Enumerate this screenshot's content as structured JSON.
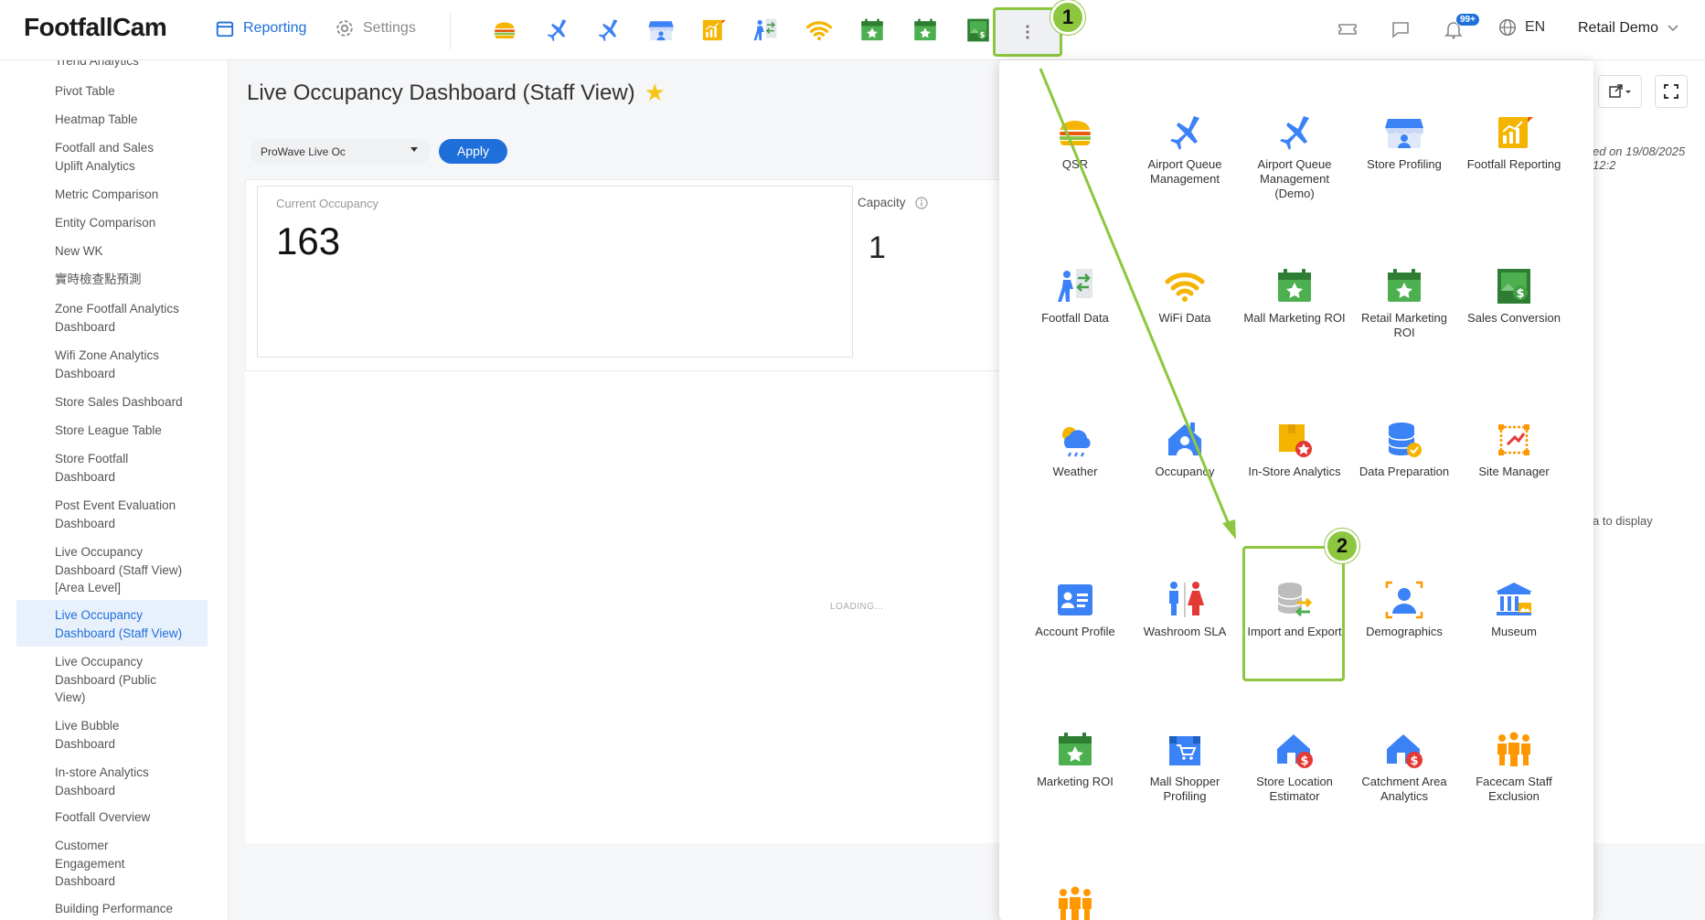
{
  "brand": {
    "name": "FootfallCam"
  },
  "nav": {
    "reporting": "Reporting",
    "settings": "Settings"
  },
  "quick_icons": [
    "burger-icon",
    "airplane-icon",
    "airplane-icon",
    "store-icon",
    "chart-report-icon",
    "people-flow-icon",
    "wifi-icon",
    "calendar-star-icon",
    "calendar-star-icon",
    "money-card-icon"
  ],
  "header": {
    "notif_badge": "99+",
    "lang": "EN",
    "user": "Retail Demo"
  },
  "callouts": {
    "one": "1",
    "two": "2"
  },
  "sidebar": {
    "items": [
      {
        "label": "Trend Analytics"
      },
      {
        "label": "Pivot Table"
      },
      {
        "label": "Heatmap Table"
      },
      {
        "label": "Footfall and Sales Uplift Analytics"
      },
      {
        "label": "Metric Comparison"
      },
      {
        "label": "Entity Comparison"
      },
      {
        "label": "New WK"
      },
      {
        "label": "實時檢查點預測"
      },
      {
        "label": "Zone Footfall Analytics Dashboard"
      },
      {
        "label": "Wifi Zone Analytics Dashboard"
      },
      {
        "label": "Store Sales Dashboard"
      },
      {
        "label": "Store League Table"
      },
      {
        "label": "Store Footfall Dashboard"
      },
      {
        "label": "Post Event Evaluation Dashboard"
      },
      {
        "label": "Live Occupancy Dashboard (Staff View) [Area Level]"
      },
      {
        "label": "Live Occupancy Dashboard (Staff View)"
      },
      {
        "label": "Live Occupancy Dashboard (Public View)"
      },
      {
        "label": "Live Bubble Dashboard"
      },
      {
        "label": "In-store Analytics Dashboard"
      },
      {
        "label": "Footfall Overview"
      },
      {
        "label": "Customer Engagement Dashboard"
      },
      {
        "label": "Building Performance"
      }
    ]
  },
  "page": {
    "title": "Live Occupancy Dashboard (Staff View)",
    "select_value": "ProWave Live Oc",
    "apply": "Apply",
    "current_occupancy_label": "Current Occupancy",
    "current_occupancy_value": "163",
    "capacity_label": "Capacity",
    "capacity_value": "1",
    "loading": "LOADING...",
    "updated_text": "ed on 19/08/2025 12:2",
    "nodata_text": "a to display"
  },
  "apps": [
    {
      "label": "QSR",
      "icon": "burger-icon"
    },
    {
      "label": "Airport Queue Management",
      "icon": "airplane-icon"
    },
    {
      "label": "Airport Queue Management (Demo)",
      "icon": "airplane-icon"
    },
    {
      "label": "Store Profiling",
      "icon": "store-icon"
    },
    {
      "label": "Footfall Reporting",
      "icon": "chart-report-icon"
    },
    {
      "label": "Footfall Data",
      "icon": "people-flow-icon"
    },
    {
      "label": "WiFi Data",
      "icon": "wifi-icon"
    },
    {
      "label": "Mall Marketing ROI",
      "icon": "calendar-star-icon"
    },
    {
      "label": "Retail Marketing ROI",
      "icon": "calendar-star-icon"
    },
    {
      "label": "Sales Conversion",
      "icon": "money-card-icon"
    },
    {
      "label": "Weather",
      "icon": "weather-icon"
    },
    {
      "label": "Occupancy",
      "icon": "house-person-icon"
    },
    {
      "label": "In-Store Analytics",
      "icon": "box-star-icon"
    },
    {
      "label": "Data Preparation",
      "icon": "database-icon"
    },
    {
      "label": "Site Manager",
      "icon": "site-manager-icon"
    },
    {
      "label": "Account Profile",
      "icon": "id-card-icon"
    },
    {
      "label": "Washroom SLA",
      "icon": "washroom-icon"
    },
    {
      "label": "Import and Export",
      "icon": "import-export-icon"
    },
    {
      "label": "Demographics",
      "icon": "demographics-icon"
    },
    {
      "label": "Museum",
      "icon": "museum-icon"
    },
    {
      "label": "Marketing ROI",
      "icon": "calendar-star-icon"
    },
    {
      "label": "Mall Shopper Profiling",
      "icon": "shop-cart-icon"
    },
    {
      "label": "Store Location Estimator",
      "icon": "house-dollar-icon"
    },
    {
      "label": "Catchment Area Analytics",
      "icon": "house-dollar-icon"
    },
    {
      "label": "Facecam Staff Exclusion",
      "icon": "staff-group-icon"
    },
    {
      "label": "",
      "icon": "staff-group-icon"
    }
  ],
  "colors": {
    "accent": "#1e6fd9",
    "callout": "#8dc63f",
    "star": "#f5c518"
  }
}
